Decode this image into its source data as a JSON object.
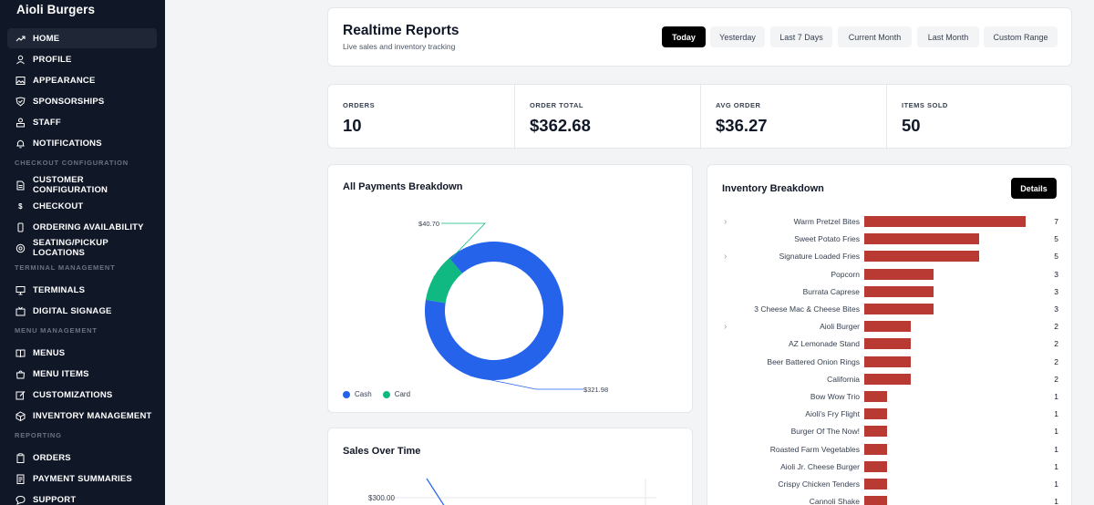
{
  "sidebar": {
    "brand": "Aioli Burgers",
    "items": [
      {
        "label": "HOME",
        "icon": "trending-up-icon"
      },
      {
        "label": "PROFILE",
        "icon": "user-icon"
      },
      {
        "label": "APPEARANCE",
        "icon": "image-icon"
      },
      {
        "label": "SPONSORSHIPS",
        "icon": "badge-icon"
      },
      {
        "label": "STAFF",
        "icon": "staff-icon"
      },
      {
        "label": "NOTIFICATIONS",
        "icon": "bell-icon"
      },
      {
        "label": "CUSTOMER CONFIGURATION",
        "icon": "document-icon"
      },
      {
        "label": "CHECKOUT",
        "icon": "dollar-icon"
      },
      {
        "label": "ORDERING AVAILABILITY",
        "icon": "phone-icon"
      },
      {
        "label": "SEATING/PICKUP LOCATIONS",
        "icon": "location-icon"
      },
      {
        "label": "TERMINALS",
        "icon": "monitor-icon"
      },
      {
        "label": "DIGITAL SIGNAGE",
        "icon": "tv-icon"
      },
      {
        "label": "MENUS",
        "icon": "book-icon"
      },
      {
        "label": "MENU ITEMS",
        "icon": "bag-icon"
      },
      {
        "label": "CUSTOMIZATIONS",
        "icon": "edit-icon"
      },
      {
        "label": "INVENTORY MANAGEMENT",
        "icon": "cube-icon"
      },
      {
        "label": "ORDERS",
        "icon": "clipboard-icon"
      },
      {
        "label": "PAYMENT SUMMARIES",
        "icon": "receipt-icon"
      },
      {
        "label": "SUPPORT",
        "icon": "chat-icon"
      }
    ],
    "sections": {
      "checkout": "CHECKOUT CONFIGURATION",
      "terminal": "TERMINAL MANAGEMENT",
      "menu": "MENU MANAGEMENT",
      "reporting": "REPORTING"
    },
    "checkout_glyph": "$"
  },
  "header": {
    "title": "Realtime Reports",
    "subtitle": "Live sales and inventory tracking",
    "filters": [
      "Today",
      "Yesterday",
      "Last 7 Days",
      "Current Month",
      "Last Month",
      "Custom Range"
    ],
    "active_filter": "Today"
  },
  "stats": [
    {
      "label": "ORDERS",
      "value": "10"
    },
    {
      "label": "ORDER TOTAL",
      "value": "$362.68"
    },
    {
      "label": "AVG ORDER",
      "value": "$36.27"
    },
    {
      "label": "ITEMS SOLD",
      "value": "50"
    }
  ],
  "payments": {
    "title": "All Payments Breakdown",
    "legend": [
      {
        "name": "Cash",
        "color": "#2563eb"
      },
      {
        "name": "Card",
        "color": "#10b981"
      }
    ]
  },
  "sales": {
    "title": "Sales Over Time",
    "tick": "$300.00"
  },
  "inventory": {
    "title": "Inventory Breakdown",
    "details_label": "Details",
    "bar_color": "#b83a33",
    "expand_glyph": "›",
    "items": [
      {
        "name": "Warm Pretzel Bites",
        "count": 7,
        "expandable": true
      },
      {
        "name": "Sweet Potato Fries",
        "count": 5,
        "expandable": false
      },
      {
        "name": "Signature Loaded Fries",
        "count": 5,
        "expandable": true
      },
      {
        "name": "Popcorn",
        "count": 3,
        "expandable": false
      },
      {
        "name": "Burrata Caprese",
        "count": 3,
        "expandable": false
      },
      {
        "name": "3 Cheese Mac & Cheese Bites",
        "count": 3,
        "expandable": false
      },
      {
        "name": "Aioli Burger",
        "count": 2,
        "expandable": true
      },
      {
        "name": "AZ Lemonade Stand",
        "count": 2,
        "expandable": false
      },
      {
        "name": "Beer Battered Onion Rings",
        "count": 2,
        "expandable": false
      },
      {
        "name": "California",
        "count": 2,
        "expandable": false
      },
      {
        "name": "Bow Wow Trio",
        "count": 1,
        "expandable": false
      },
      {
        "name": "Aioli's Fry Flight",
        "count": 1,
        "expandable": false
      },
      {
        "name": "Burger Of The Now!",
        "count": 1,
        "expandable": false
      },
      {
        "name": "Roasted Farm Vegetables",
        "count": 1,
        "expandable": false
      },
      {
        "name": "Aioli Jr. Cheese Burger",
        "count": 1,
        "expandable": false
      },
      {
        "name": "Crispy Chicken Tenders",
        "count": 1,
        "expandable": false
      },
      {
        "name": "Cannoli Shake",
        "count": 1,
        "expandable": false
      }
    ]
  },
  "chart_data": [
    {
      "type": "pie",
      "title": "All Payments Breakdown",
      "categories": [
        "Cash",
        "Card"
      ],
      "values": [
        321.98,
        40.7
      ],
      "labels": [
        "$321.98",
        "$40.70"
      ],
      "colors": [
        "#2563eb",
        "#10b981"
      ],
      "legend": "bottom-left"
    },
    {
      "type": "bar",
      "title": "Inventory Breakdown",
      "orientation": "horizontal",
      "categories": [
        "Warm Pretzel Bites",
        "Sweet Potato Fries",
        "Signature Loaded Fries",
        "Popcorn",
        "Burrata Caprese",
        "3 Cheese Mac & Cheese Bites",
        "Aioli Burger",
        "AZ Lemonade Stand",
        "Beer Battered Onion Rings",
        "California",
        "Bow Wow Trio",
        "Aioli's Fry Flight",
        "Burger Of The Now!",
        "Roasted Farm Vegetables",
        "Aioli Jr. Cheese Burger",
        "Crispy Chicken Tenders",
        "Cannoli Shake"
      ],
      "values": [
        7,
        5,
        5,
        3,
        3,
        3,
        2,
        2,
        2,
        2,
        1,
        1,
        1,
        1,
        1,
        1,
        1
      ]
    },
    {
      "type": "line",
      "title": "Sales Over Time",
      "ytick_labels": [
        "$300.00"
      ]
    }
  ]
}
